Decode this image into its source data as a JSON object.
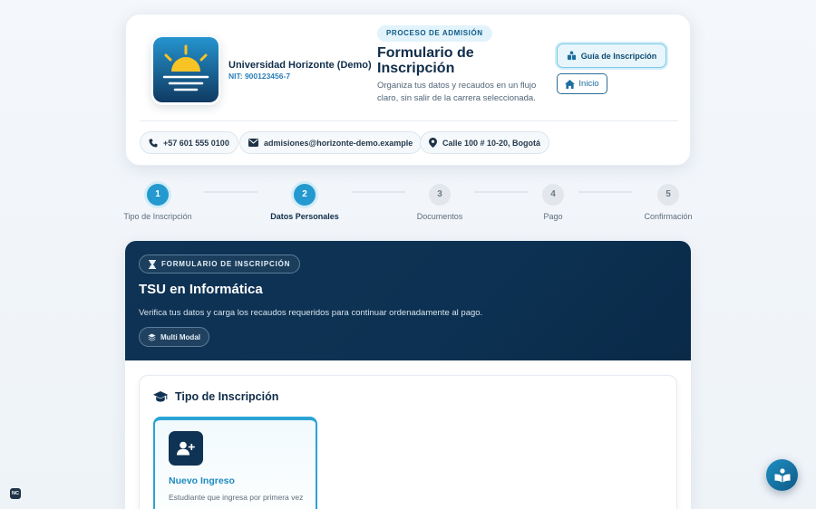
{
  "header": {
    "university_name": "Universidad Horizonte (Demo)",
    "nit": "NIT: 900123456-7",
    "process_badge": "PROCESO DE ADMISIÓN",
    "form_title": "Formulario de Inscripción",
    "form_description": "Organiza tus datos y recaudos en un flujo claro, sin salir de la carrera seleccionada.",
    "guide_button": "Guía de Inscripción",
    "home_button": "Inicio",
    "contacts": {
      "phone": "+57 601 555 0100",
      "email": "admisiones@horizonte-demo.example",
      "address": "Calle 100 # 10-20, Bogotá"
    }
  },
  "stepper": {
    "steps": [
      {
        "number": "1",
        "label": "Tipo de Inscripción",
        "state": "done"
      },
      {
        "number": "2",
        "label": "Datos Personales",
        "state": "active"
      },
      {
        "number": "3",
        "label": "Documentos",
        "state": "pending"
      },
      {
        "number": "4",
        "label": "Pago",
        "state": "pending"
      },
      {
        "number": "5",
        "label": "Confirmación",
        "state": "pending"
      }
    ]
  },
  "banner": {
    "badge": "FORMULARIO DE INSCRIPCIÓN",
    "title": "TSU en Informática",
    "description": "Verifica tus datos y carga los recaudos requeridos para continuar ordenadamente al pago.",
    "mode": "Multi Modal"
  },
  "section": {
    "title": "Tipo de Inscripción",
    "option": {
      "title": "Nuevo Ingreso",
      "description": "Estudiante que ingresa por primera vez"
    }
  },
  "corner_badge": "NC",
  "colors": {
    "accent": "#2399cf",
    "navy": "#0f3354",
    "text": "#0f2d4a"
  }
}
